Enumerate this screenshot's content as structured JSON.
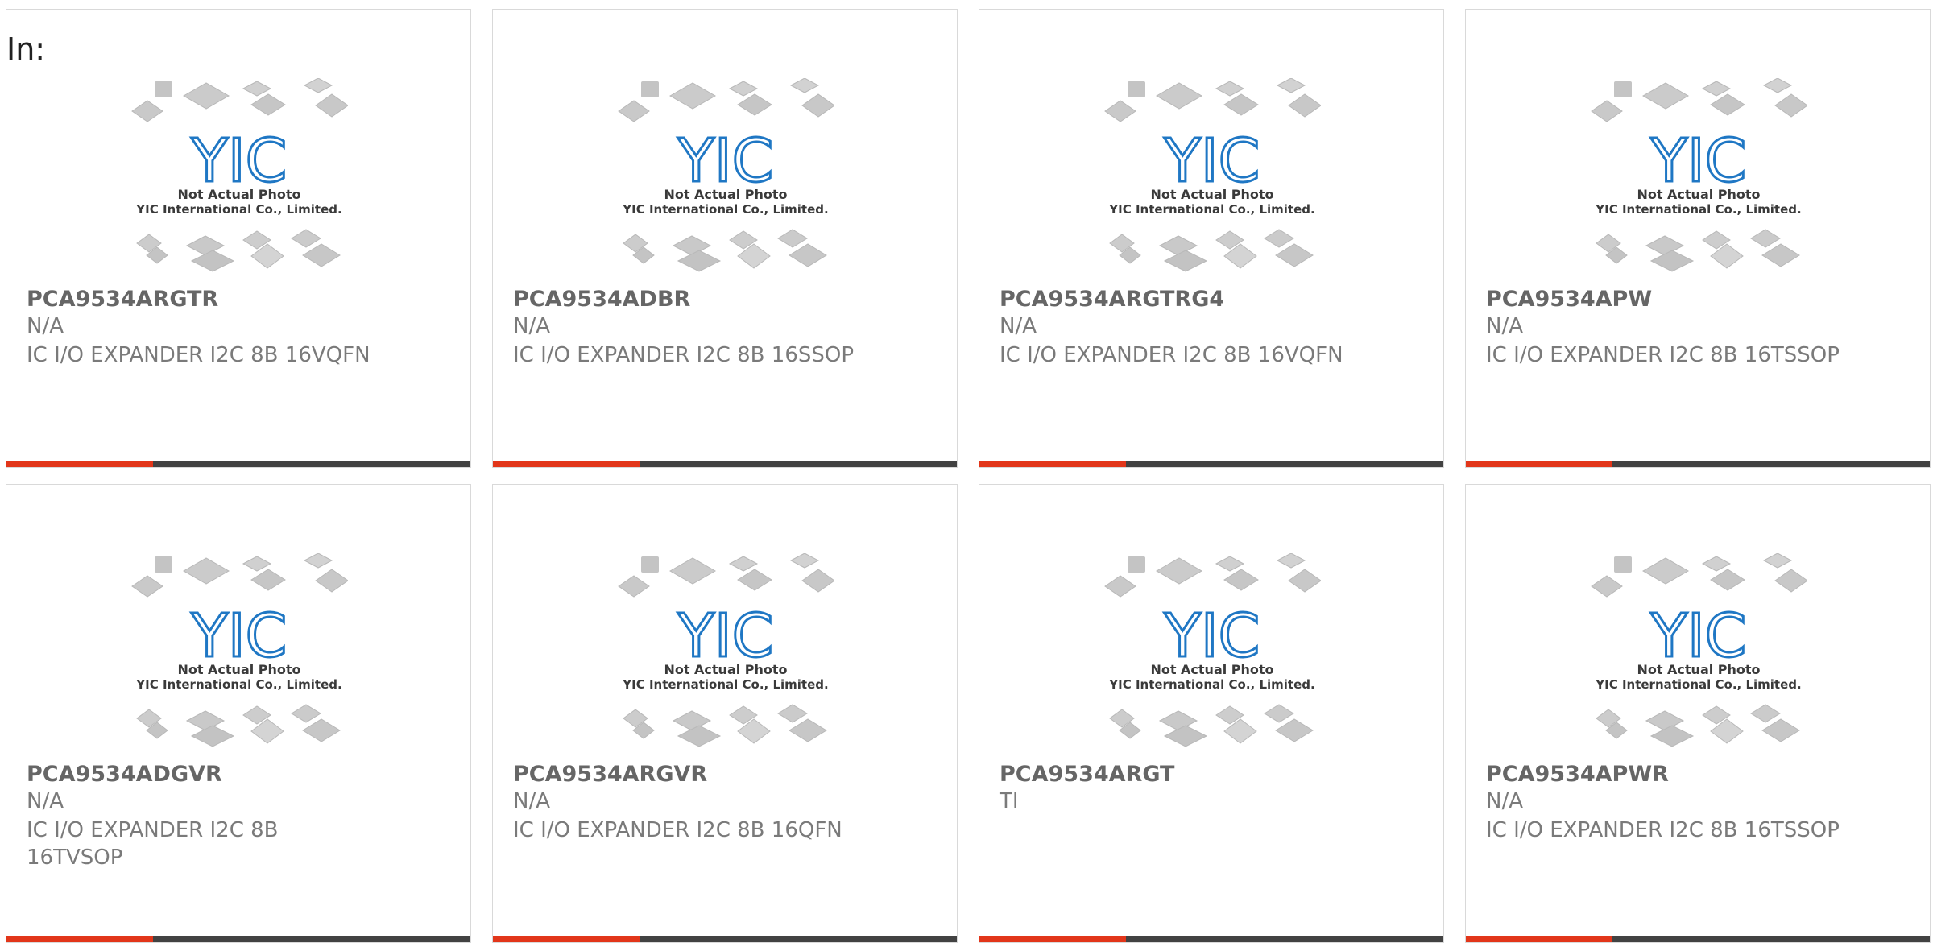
{
  "page": {
    "label": "In:"
  },
  "placeholder": {
    "line1": "Not Actual Photo",
    "line2": "YIC International Co., Limited.",
    "logo": "YIC"
  },
  "colors": {
    "accent": "#e2361a",
    "bar": "#424242",
    "logo": "#1f77c4",
    "text": "#7a7a7a"
  },
  "products": [
    {
      "part": "PCA9534ARGTR",
      "mfr": "N/A",
      "desc": "IC I/O EXPANDER I2C 8B 16VQFN"
    },
    {
      "part": "PCA9534ADBR",
      "mfr": "N/A",
      "desc": "IC I/O EXPANDER I2C 8B 16SSOP"
    },
    {
      "part": "PCA9534ARGTRG4",
      "mfr": "N/A",
      "desc": "IC I/O EXPANDER I2C 8B 16VQFN"
    },
    {
      "part": "PCA9534APW",
      "mfr": "N/A",
      "desc": "IC I/O EXPANDER I2C 8B 16TSSOP"
    },
    {
      "part": "PCA9534ADGVR",
      "mfr": "N/A",
      "desc": "IC I/O EXPANDER I2C 8B 16TVSOP"
    },
    {
      "part": "PCA9534ARGVR",
      "mfr": "N/A",
      "desc": "IC I/O EXPANDER I2C 8B 16QFN"
    },
    {
      "part": "PCA9534ARGT",
      "mfr": "TI",
      "desc": ""
    },
    {
      "part": "PCA9534APWR",
      "mfr": "N/A",
      "desc": "IC I/O EXPANDER I2C 8B 16TSSOP"
    }
  ]
}
